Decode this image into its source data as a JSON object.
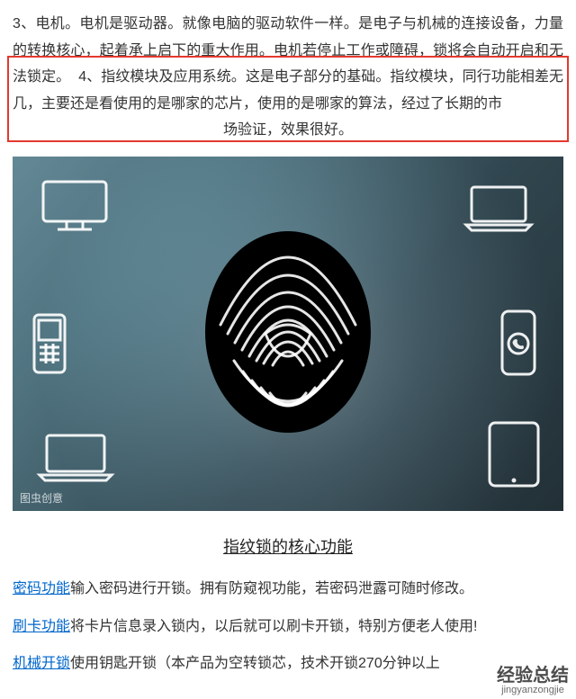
{
  "paragraph": {
    "line1": "3、电机。电机是驱动器。就像电脑的驱动软件一样。是电子与机械的连接设备，力量的转换核心，起着承上启下的重大作用。电机若停止工作或障碍，锁将会自动开启和无法锁定。",
    "line2": "4、指纹模块及应用系统。这是电子部分的基础。指纹模块，同行功能相差无几，主要还是看使用的是哪家的芯片，使用的是哪家的算法，经过了长期的市",
    "line3": "场验证，效果很好。"
  },
  "image_credit": "图虫创意",
  "section_title": "指纹锁的核心功能",
  "features": [
    {
      "link": "密码功能",
      "text": "输入密码进行开锁。拥有防窥视功能，若密码泄露可随时修改。"
    },
    {
      "link": "刷卡功能",
      "text": "将卡片信息录入锁内，以后就可以刷卡开锁，特别方便老人使用!"
    },
    {
      "link": "机械开锁",
      "text": "使用钥匙开锁（本产品为空转锁芯，技术开锁270分钟以上"
    }
  ],
  "watermark": {
    "main": "经验总结",
    "sub": "jingyanzongjie"
  }
}
